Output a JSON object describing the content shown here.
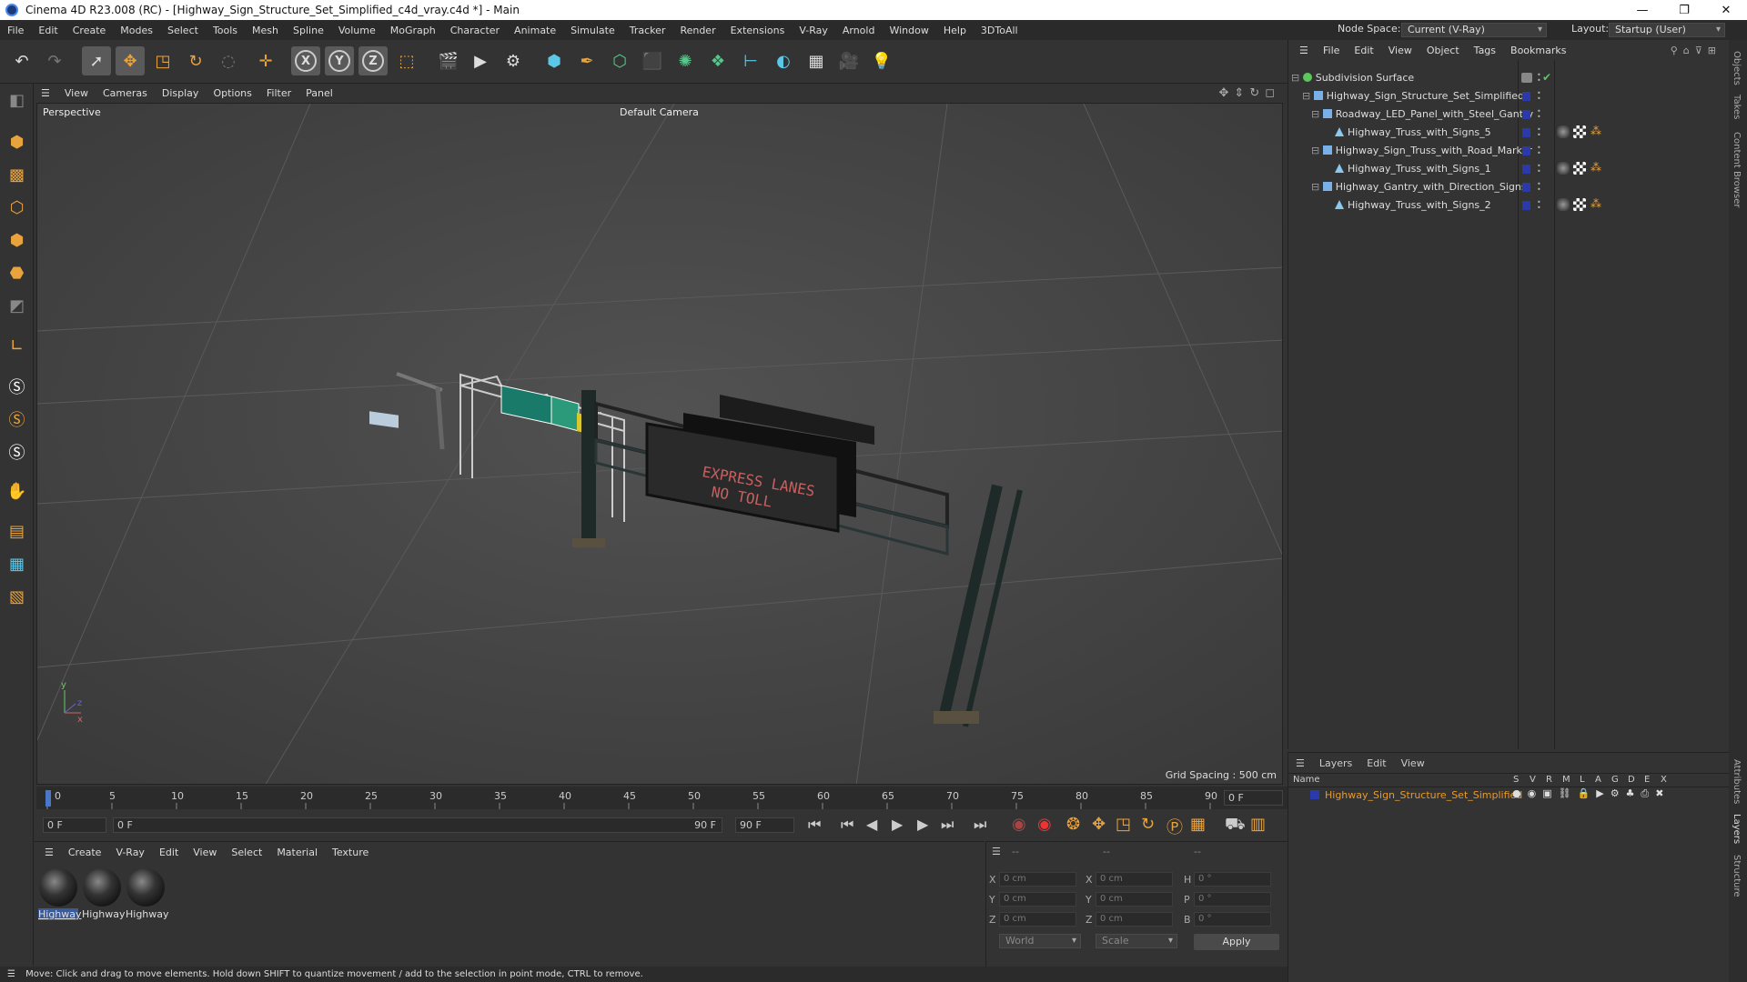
{
  "title": "Cinema 4D R23.008 (RC) - [Highway_Sign_Structure_Set_Simplified_c4d_vray.c4d *] - Main",
  "menu": [
    "File",
    "Edit",
    "Create",
    "Modes",
    "Select",
    "Tools",
    "Mesh",
    "Spline",
    "Volume",
    "MoGraph",
    "Character",
    "Animate",
    "Simulate",
    "Tracker",
    "Render",
    "Extensions",
    "V-Ray",
    "Arnold",
    "Window",
    "Help",
    "3DToAll"
  ],
  "node_space": {
    "label": "Node Space:",
    "value": "Current (V-Ray)"
  },
  "layout": {
    "label": "Layout:",
    "value": "Startup (User)"
  },
  "viewport": {
    "menu": [
      "View",
      "Cameras",
      "Display",
      "Options",
      "Filter",
      "Panel"
    ],
    "name": "Perspective",
    "camera": "Default Camera",
    "grid_spacing": "Grid Spacing : 500 cm",
    "sign_text1": "EXPRESS LANES",
    "sign_text2": "NO TOLL"
  },
  "timeline": {
    "ticks": [
      "0",
      "5",
      "10",
      "15",
      "20",
      "25",
      "30",
      "35",
      "40",
      "45",
      "50",
      "55",
      "60",
      "65",
      "70",
      "75",
      "80",
      "85",
      "90"
    ],
    "current": "0 F"
  },
  "transport": {
    "start": "0 F",
    "range_start": "0 F",
    "range_end": "90 F",
    "end": "90 F"
  },
  "materials": {
    "menu": [
      "Create",
      "V-Ray",
      "Edit",
      "View",
      "Select",
      "Material",
      "Texture"
    ],
    "items": [
      "Highway",
      "Highway",
      "Highway"
    ]
  },
  "coords": {
    "header": [
      "--",
      "--",
      "--"
    ],
    "rows": [
      {
        "a": "X",
        "av": "0 cm",
        "b": "X",
        "bv": "0 cm",
        "c": "H",
        "cv": "0 °"
      },
      {
        "a": "Y",
        "av": "0 cm",
        "b": "Y",
        "bv": "0 cm",
        "c": "P",
        "cv": "0 °"
      },
      {
        "a": "Z",
        "av": "0 cm",
        "b": "Z",
        "bv": "0 cm",
        "c": "B",
        "cv": "0 °"
      }
    ],
    "world": "World",
    "scale": "Scale",
    "apply": "Apply"
  },
  "status": "Move: Click and drag to move elements. Hold down SHIFT to quantize movement / add to the selection in point mode, CTRL to remove.",
  "objects": {
    "menu": [
      "File",
      "Edit",
      "View",
      "Object",
      "Tags",
      "Bookmarks"
    ],
    "tree": [
      "Subdivision Surface",
      "Highway_Sign_Structure_Set_Simplified",
      "Roadway_LED_Panel_with_Steel_Gantry",
      "Highway_Truss_with_Signs_5",
      "Highway_Sign_Truss_with_Road_Marker",
      "Highway_Truss_with_Signs_1",
      "Highway_Gantry_with_Direction_Signs",
      "Highway_Truss_with_Signs_2"
    ]
  },
  "layers": {
    "menu": [
      "Layers",
      "Edit",
      "View"
    ],
    "columns": [
      "Name",
      "S",
      "V",
      "R",
      "M",
      "L",
      "A",
      "G",
      "D",
      "E",
      "X"
    ],
    "row": "Highway_Sign_Structure_Set_Simplified"
  },
  "side_tabs": [
    "Objects",
    "Takes",
    "Content Browser",
    "Attributes",
    "Layers",
    "Structure"
  ],
  "colors": {
    "layer_color": "#2a3aaa",
    "selected_text": "#e89a2a"
  }
}
